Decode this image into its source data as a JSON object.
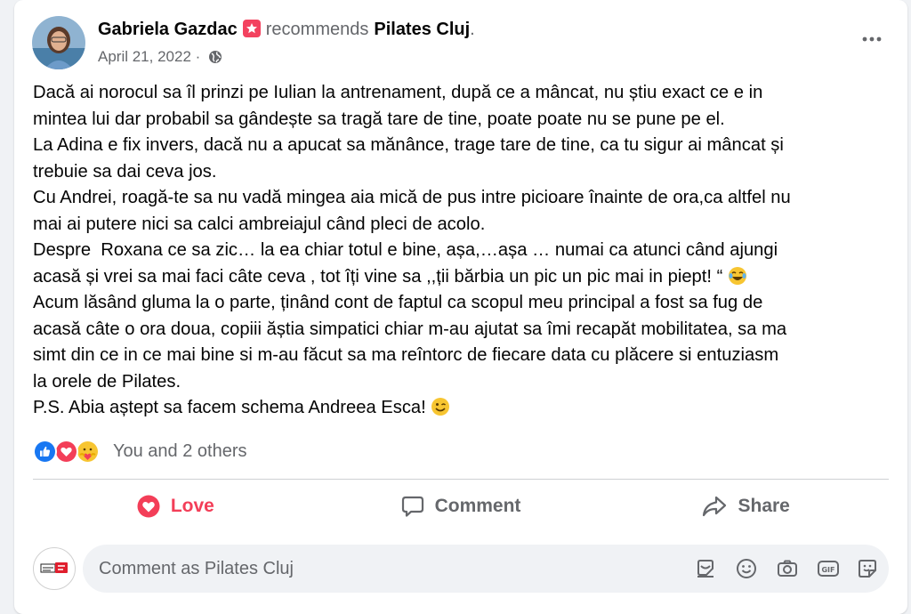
{
  "post": {
    "author": "Gabriela Gazdac",
    "verb": "recommends",
    "page_name": "Pilates Cluj",
    "punct": ".",
    "date": "April 21, 2022",
    "meta_sep": "·",
    "lines": [
      "Dacă ai norocul sa îl prinzi pe Iulian la antrenament, după ce a mâncat, nu știu exact ce e in",
      "mintea lui dar probabil sa gândește sa tragă tare de tine, poate poate nu se pune pe el.",
      "La Adina e fix invers, dacă nu a apucat sa mănânce, trage tare de tine, ca tu sigur ai mâncat și",
      "trebuie sa dai ceva jos.",
      "Cu Andrei, roagă-te sa nu vadă mingea aia mică de pus intre picioare înainte de ora,ca altfel nu",
      "mai ai putere nici sa calci ambreiajul când pleci de acolo.",
      "Despre  Roxana ce sa zic… la ea chiar totul e bine, așa,…așa … numai ca atunci când ajungi",
      "acasă și vrei sa mai faci câte ceva , tot îți vine sa ,,ții bărbia un pic un pic mai in piept! “",
      "Acum lăsând gluma la o parte, ținând cont de faptul ca scopul meu principal a fost sa fug de",
      "acasă câte o ora doua, copiii ăștia simpatici chiar m-au ajutat sa îmi recapăt mobilitatea, sa ma",
      "simt din ce in ce mai bine si m-au făcut sa ma reîntorc de fiecare data cu plăcere si entuziasm",
      "la orele de Pilates.",
      "P.S. Abia aștept sa facem schema Andreea Esca!"
    ]
  },
  "reactions": {
    "summary": "You and 2 others",
    "icons": [
      "like-icon",
      "love-icon",
      "care-icon"
    ]
  },
  "actions": {
    "love": "Love",
    "comment": "Comment",
    "share": "Share"
  },
  "comment_box": {
    "placeholder": "Comment as Pilates Cluj",
    "tools": [
      "sticker-icon",
      "emoji-icon",
      "camera-icon",
      "gif-icon",
      "avatar-sticker-icon"
    ]
  },
  "colors": {
    "love": "#f33e58",
    "like": "#1877f2",
    "secondary_text": "#65676b"
  }
}
